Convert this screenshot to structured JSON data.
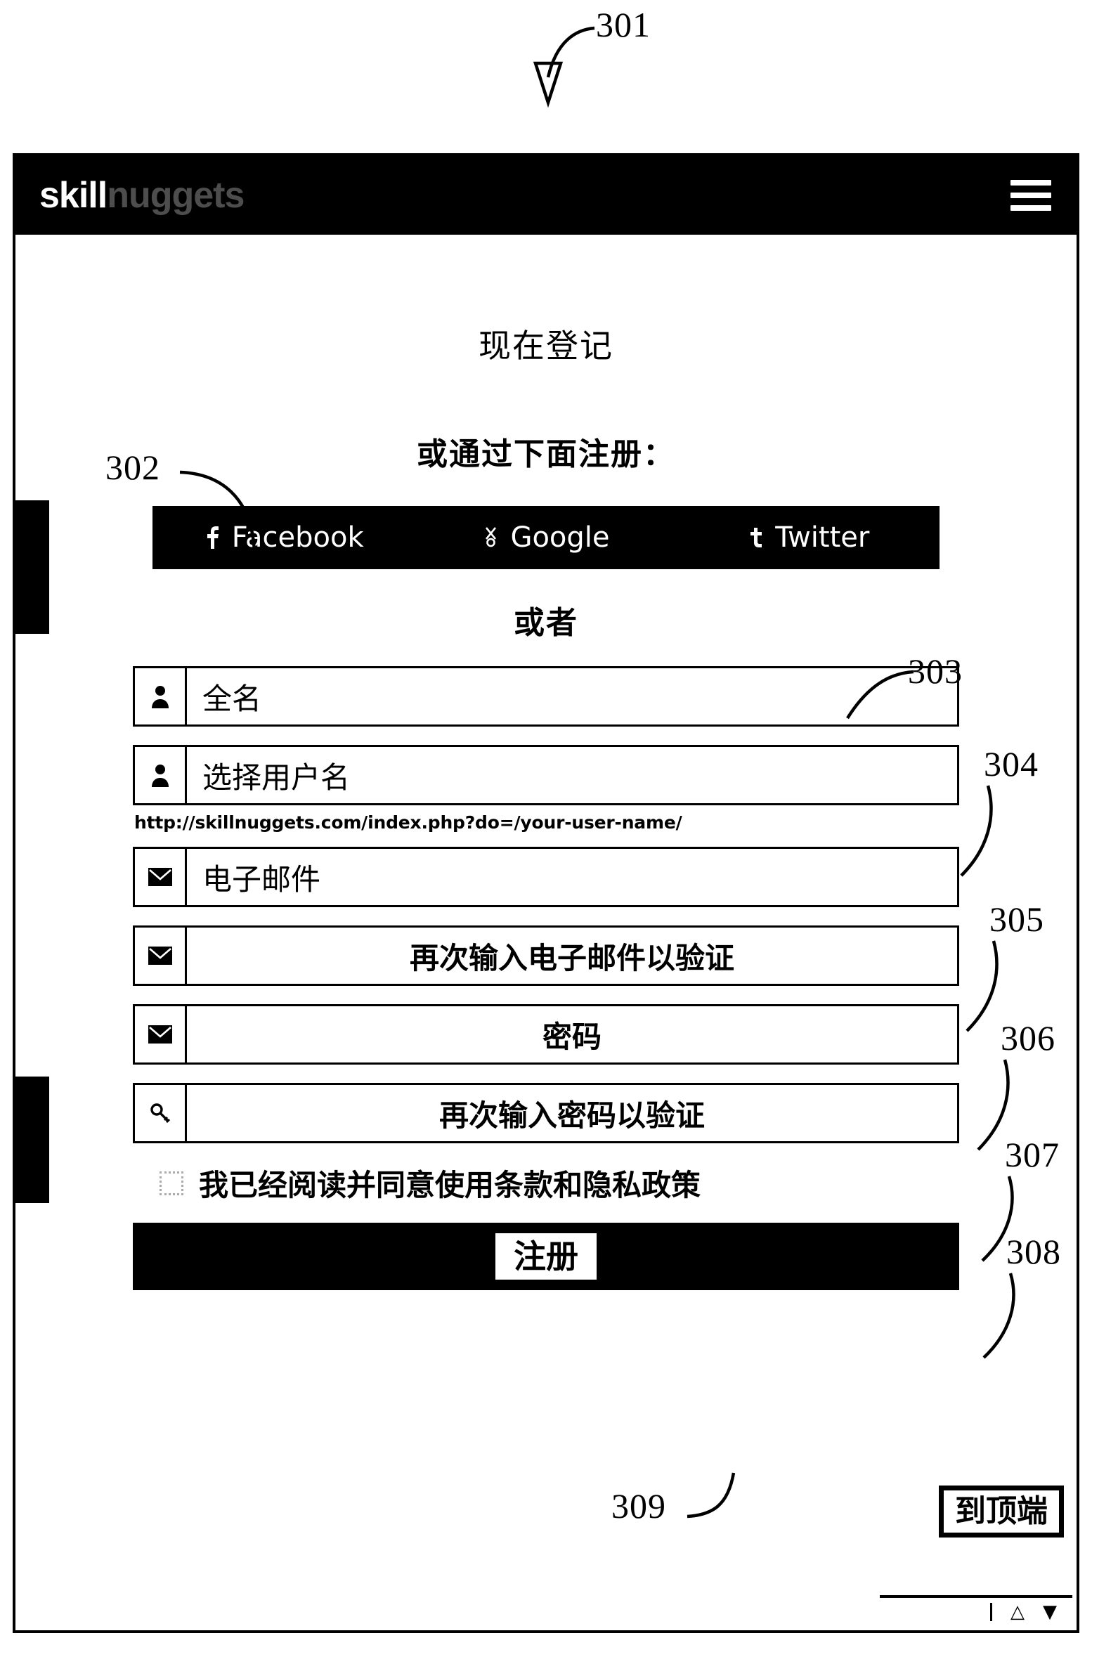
{
  "figure": {
    "number": "301",
    "callouts": [
      {
        "id": "301",
        "label": "301"
      },
      {
        "id": "302",
        "label": "302"
      },
      {
        "id": "303",
        "label": "303"
      },
      {
        "id": "304",
        "label": "304"
      },
      {
        "id": "305",
        "label": "305"
      },
      {
        "id": "306",
        "label": "306"
      },
      {
        "id": "307",
        "label": "307"
      },
      {
        "id": "308",
        "label": "308"
      },
      {
        "id": "309",
        "label": "309"
      }
    ]
  },
  "topbar": {
    "logo_strong": "skill",
    "logo_soft": "nuggets",
    "menu_icon": "hamburger-icon"
  },
  "page": {
    "title": "现在登记",
    "social_prompt": "或通过下面注册：",
    "divider": "或者"
  },
  "social": {
    "providers": [
      {
        "name": "Facebook",
        "label": "Facebook",
        "glyph": "f",
        "icon": "facebook-icon"
      },
      {
        "name": "Google",
        "label": "Google",
        "glyph": "ɣ",
        "icon": "google-plus-icon"
      },
      {
        "name": "Twitter",
        "label": "Twitter",
        "glyph": "t",
        "icon": "twitter-icon"
      }
    ]
  },
  "form": {
    "fields": [
      {
        "key": "fullname",
        "placeholder": "全名",
        "icon": "user-icon",
        "align": "left",
        "callout": "303"
      },
      {
        "key": "username",
        "placeholder": "选择用户名",
        "icon": "user-icon",
        "align": "left",
        "callout": "304"
      },
      {
        "key": "email",
        "placeholder": "电子邮件",
        "icon": "envelope-icon",
        "align": "left",
        "callout": "305"
      },
      {
        "key": "email_confirm",
        "placeholder": "再次输入电子邮件以验证",
        "icon": "envelope-icon",
        "align": "center",
        "callout": "306"
      },
      {
        "key": "password",
        "placeholder": "密码",
        "icon": "envelope-icon",
        "align": "center",
        "callout": "307"
      },
      {
        "key": "password_confirm",
        "placeholder": "再次输入密码以验证",
        "icon": "key-icon",
        "align": "center",
        "callout": "308"
      }
    ],
    "username_hint": "http://skillnuggets.com/index.php?do=/your-user-name/",
    "terms_label": "我已经阅读并同意使用条款和隐私政策",
    "terms_checked": false,
    "submit_label": "注册"
  },
  "footer": {
    "back_to_top": "到顶端"
  },
  "edge_tabs": [
    {
      "id": "tab-1",
      "label": ""
    },
    {
      "id": "tab-2",
      "label": ""
    }
  ],
  "colors": {
    "ink": "#000000",
    "paper": "#ffffff",
    "logo_soft": "#8c8c8c"
  }
}
